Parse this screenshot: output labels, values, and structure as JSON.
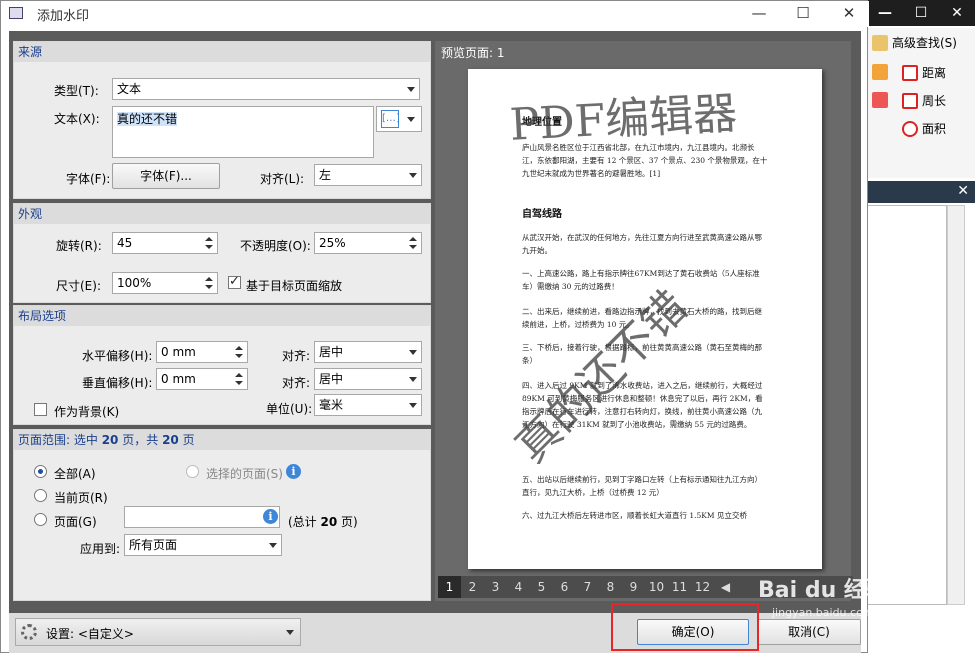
{
  "background_app": {
    "tools": {
      "advanced_find": "高级查找(S)",
      "distance": "距离",
      "perimeter": "周长",
      "area": "面积"
    }
  },
  "dialog": {
    "title": "添加水印",
    "source": {
      "heading": "来源",
      "type_label": "类型(T):",
      "type_value": "文本",
      "text_label": "文本(X):",
      "text_value": "真的还不错",
      "font_label": "字体(F):",
      "font_button": "字体(F)...",
      "align_label": "对齐(L):",
      "align_value": "左"
    },
    "appearance": {
      "heading": "外观",
      "rotate_label": "旋转(R):",
      "rotate_value": "45",
      "opacity_label": "不透明度(O):",
      "opacity_value": "25%",
      "size_label": "尺寸(E):",
      "size_value": "100%",
      "scale_label": "基于目标页面缩放",
      "scale_checked": true
    },
    "layout": {
      "heading": "布局选项",
      "h_offset_label": "水平偏移(H):",
      "h_offset_value": "0 mm",
      "h_align_label": "对齐:",
      "h_align_value": "居中",
      "v_offset_label": "垂直偏移(H):",
      "v_offset_value": "0 mm",
      "v_align_label": "对齐:",
      "v_align_value": "居中",
      "background_label": "作为背景(K)",
      "background_checked": false,
      "unit_label": "单位(U):",
      "unit_value": "毫米"
    },
    "page_range": {
      "heading_prefix": "页面范围: 选中",
      "selected": "20",
      "heading_mid": "页，共",
      "total": "20",
      "heading_suffix": "页",
      "all_label": "全部(A)",
      "selected_pages_label": "选择的页面(S)",
      "current_label": "当前页(R)",
      "pages_label": "页面(G)",
      "pages_value": "",
      "count_prefix": "(总计",
      "count_value": "20",
      "count_suffix": "页)",
      "apply_label": "应用到:",
      "apply_value": "所有页面"
    },
    "preview": {
      "title": "预览页面: 1",
      "watermark_1": "PDF编辑器",
      "watermark_2": "真的还不错",
      "heading_1": "地理位置",
      "para_1": "庐山风景名胜区位于江西省北部，在九江市境内，九江县境内。北濒长江，东依鄱阳湖，主要有 12 个景区、37 个景点、230 个景物景观，在十九世纪末就成为世界著名的避暑胜地。[1]",
      "heading_2": "自驾线路",
      "para_2": "从武汉开始，在武汉的任何地方，先往江夏方向行进至武黄高速公路从鄂九开始。",
      "para_3": "一、上高速公路，路上有指示牌往67KM到达了黄石收费站（5人座标准车）需缴纳 30 元的过路费！",
      "para_4": "二、出来后，继续前进，看路边指示牌，找到去黄石大桥的路，找到后继续前进，上桥，过桥费为 10 元。",
      "para_5": "三、下桥后，接着行驶，根据路标，前往黄黄高速公路（黄石至黄梅的那条）",
      "para_6": "四、进入后过 9KM 就到了浠水收费站，进入之后，继续前行，大概经过 89KM 可到黄梅服务区进行休息和整顿！休息完了以后，再行 2KM，看指示牌后在行车进行转，注意打右转向灯，换线，前往黄小高速公路（九江方向）在行驶 31KM 就到了小池收费站，需缴纳 55 元的过路费。",
      "para_7": "五、出站以后继续前行，见到丁字路口左转（上有标示通知往九江方向）直行，见九江大桥，上桥（过桥费 12 元）",
      "para_8": "六、过九江大桥后左转进市区，顺着长虹大道直行 1.5KM 见立交桥",
      "pages": [
        "1",
        "2",
        "3",
        "4",
        "5",
        "6",
        "7",
        "8",
        "9",
        "10",
        "11",
        "12"
      ],
      "current_page": "1"
    },
    "footer": {
      "settings_label": "设置: <自定义>",
      "ok_label": "确定(O)",
      "cancel_label": "取消(C)"
    }
  },
  "overlay": {
    "brand": "Bai du 经验",
    "brand_sub": "jingyan.baidu.com",
    "highlight_color": "#e8262a"
  }
}
